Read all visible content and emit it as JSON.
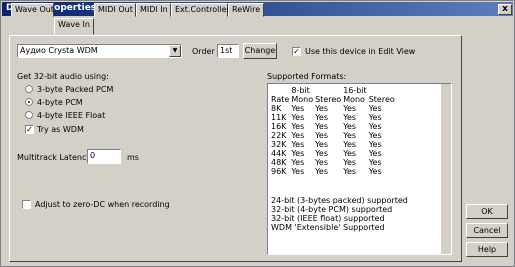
{
  "window": {
    "title": "Device Properties",
    "close": "x"
  },
  "tabs": [
    "Wave Out",
    "Wave In",
    "MIDI Out",
    "MIDI In",
    "Ext.Controller",
    "ReWire"
  ],
  "device": {
    "selected": "Аудио Crysta WDM",
    "order_label": "Order",
    "order_value": "1st",
    "change_label": "Change",
    "use_device_label": "Use this device in Edit View",
    "use_device_checked": true
  },
  "audio": {
    "heading": "Get 32-bit audio using:",
    "options": [
      "3-byte Packed PCM",
      "4-byte PCM",
      "4-byte IEEE Float"
    ],
    "selected_index": 1,
    "try_wdm_label": "Try as WDM",
    "try_wdm_checked": true
  },
  "latency": {
    "label": "Multitrack Latency",
    "value": "0",
    "unit": "ms"
  },
  "zero_dc": {
    "label": "Adjust to zero-DC when recording",
    "checked": false
  },
  "formats": {
    "heading": "Supported Formats:",
    "group_headers": [
      "8-bit",
      "16-bit"
    ],
    "headers": [
      "Rate",
      "Mono",
      "Stereo",
      "Mono",
      "Stereo"
    ],
    "rows": [
      [
        "8K",
        "Yes",
        "Yes",
        "Yes",
        "Yes"
      ],
      [
        "11K",
        "Yes",
        "Yes",
        "Yes",
        "Yes"
      ],
      [
        "16K",
        "Yes",
        "Yes",
        "Yes",
        "Yes"
      ],
      [
        "22K",
        "Yes",
        "Yes",
        "Yes",
        "Yes"
      ],
      [
        "32K",
        "Yes",
        "Yes",
        "Yes",
        "Yes"
      ],
      [
        "44K",
        "Yes",
        "Yes",
        "Yes",
        "Yes"
      ],
      [
        "48K",
        "Yes",
        "Yes",
        "Yes",
        "Yes"
      ],
      [
        "96K",
        "Yes",
        "Yes",
        "Yes",
        "Yes"
      ]
    ],
    "notes": [
      "24-bit (3-bytes packed) supported",
      "32-bit (4-byte PCM) supported",
      "32-bit (IEEE float) supported",
      "WDM 'Extensible' Supported"
    ]
  },
  "buttons": {
    "ok": "OK",
    "cancel": "Cancel",
    "help": "Help"
  }
}
